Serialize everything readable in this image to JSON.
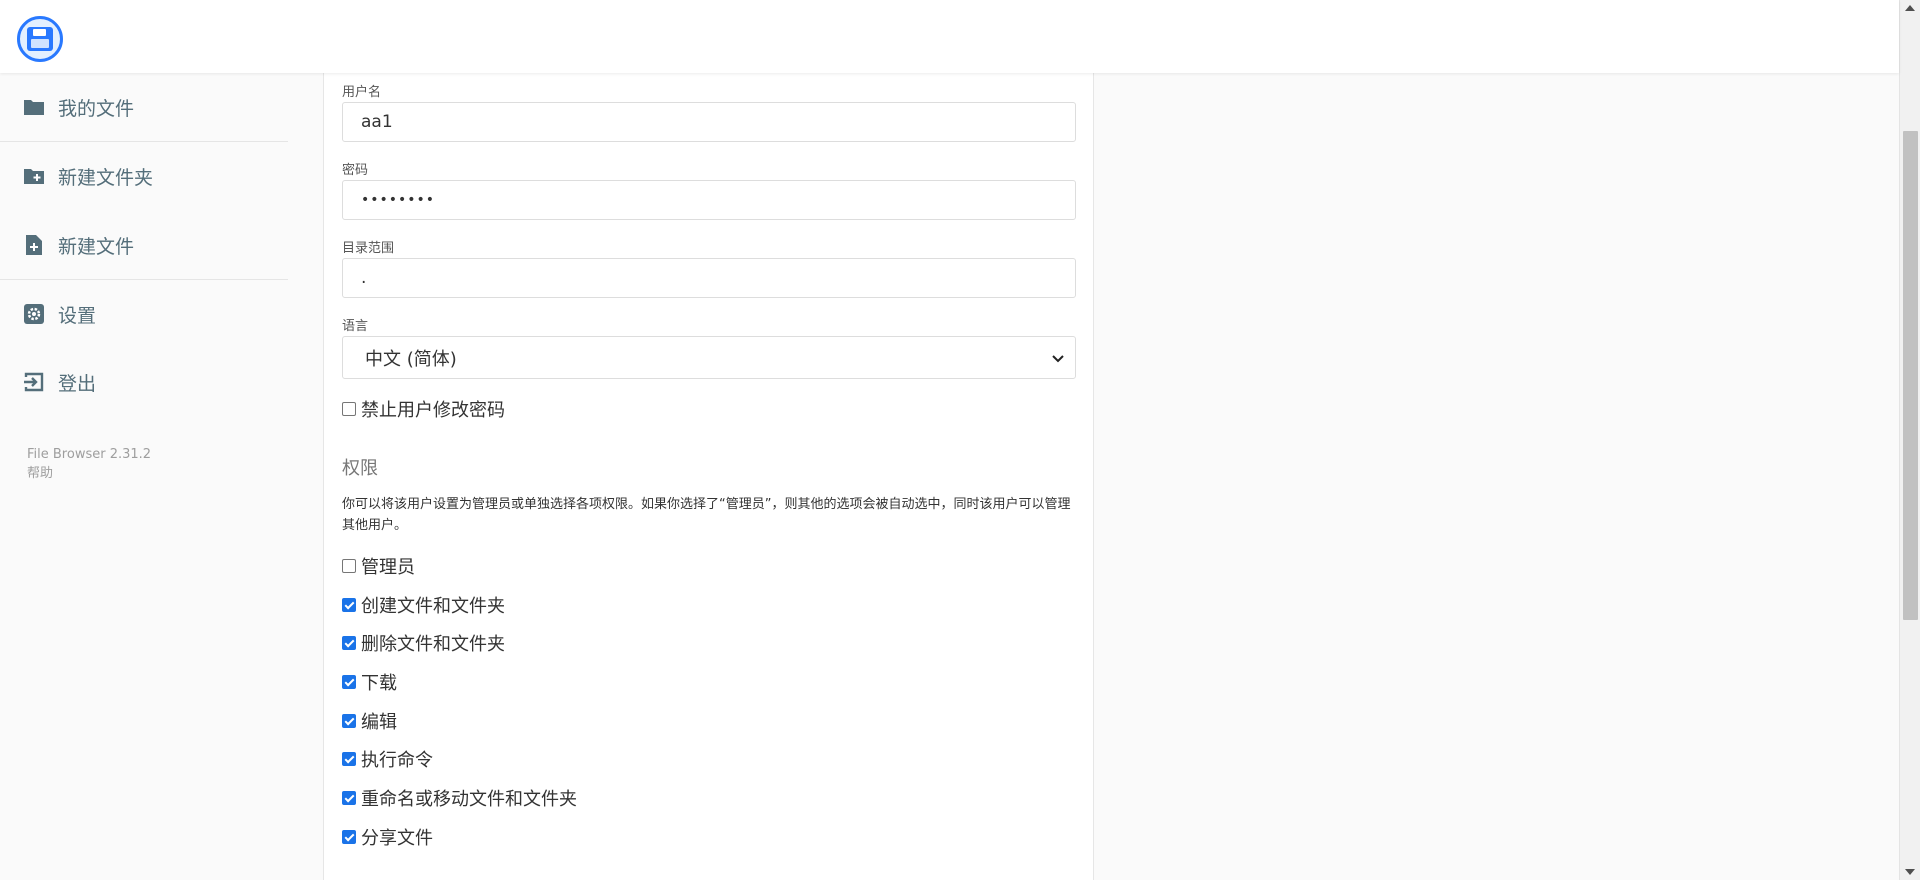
{
  "nav": {
    "my_files": "我的文件",
    "new_folder": "新建文件夹",
    "new_file": "新建文件",
    "settings": "设置",
    "logout": "登出"
  },
  "footer": {
    "version": "File Browser 2.31.2",
    "help": "帮助"
  },
  "form": {
    "username_label": "用户名",
    "username_value": "aa1",
    "password_label": "密码",
    "password_value": "••••••••",
    "scope_label": "目录范围",
    "scope_value": ".",
    "language_label": "语言",
    "language_value": "中文 (简体)",
    "lock_password_label": "禁止用户修改密码"
  },
  "permissions": {
    "title": "权限",
    "description": "你可以将该用户设置为管理员或单独选择各项权限。如果你选择了“管理员”，则其他的选项会被自动选中，同时该用户可以管理其他用户。",
    "items": [
      {
        "label": "管理员",
        "checked": false
      },
      {
        "label": "创建文件和文件夹",
        "checked": true
      },
      {
        "label": "删除文件和文件夹",
        "checked": true
      },
      {
        "label": "下载",
        "checked": true
      },
      {
        "label": "编辑",
        "checked": true
      },
      {
        "label": "执行命令",
        "checked": true
      },
      {
        "label": "重命名或移动文件和文件夹",
        "checked": true
      },
      {
        "label": "分享文件",
        "checked": true
      }
    ]
  },
  "colors": {
    "accent": "#2979ff",
    "checkbox": "#1a73e8",
    "nav_text": "#546e7a"
  }
}
